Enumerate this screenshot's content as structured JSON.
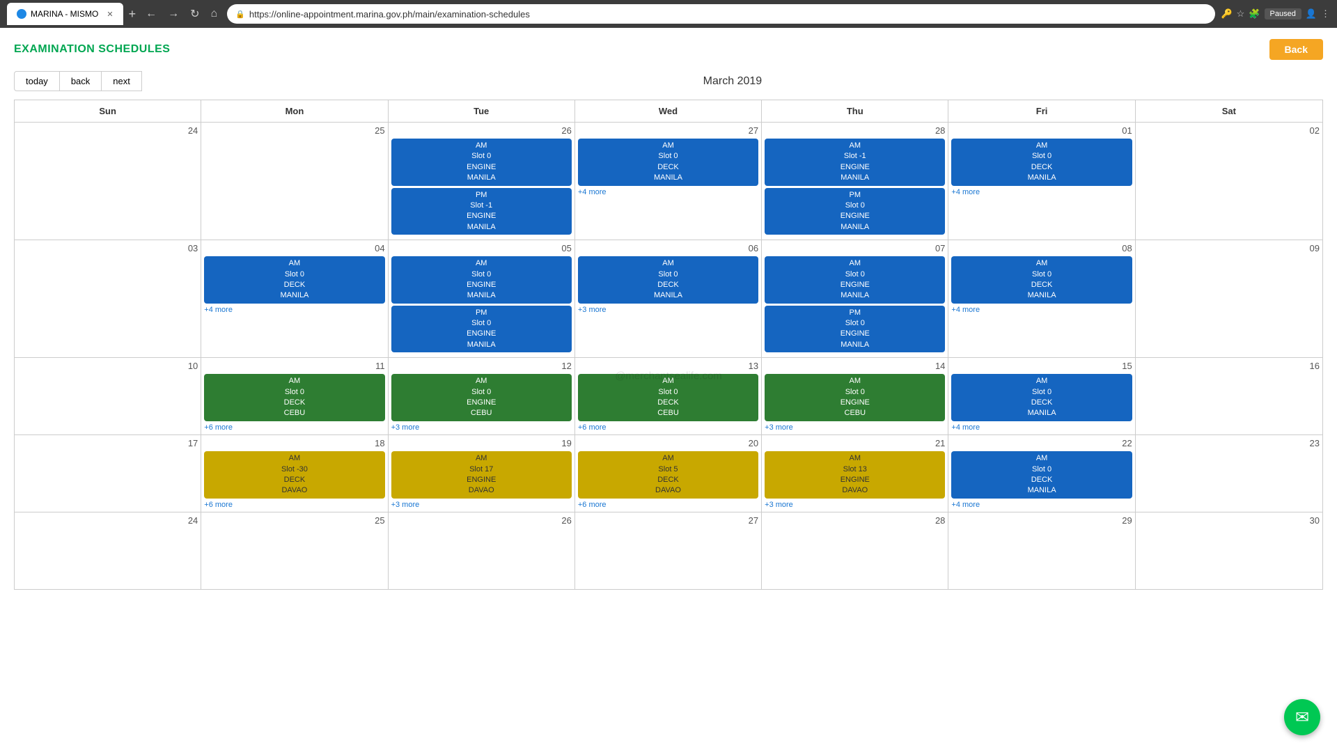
{
  "browser": {
    "tab_title": "MARINA - MISMO",
    "url": "https://online-appointment.marina.gov.ph/main/examination-schedules",
    "paused_label": "Paused"
  },
  "page": {
    "title": "EXAMINATION SCHEDULES",
    "back_button": "Back"
  },
  "calendar": {
    "nav": {
      "today": "today",
      "back": "back",
      "next": "next"
    },
    "month_label": "March 2019",
    "headers": [
      "Sun",
      "Mon",
      "Tue",
      "Wed",
      "Thu",
      "Fri",
      "Sat"
    ],
    "watermark": "@merchantsealife.com"
  },
  "rows": [
    {
      "cells": [
        {
          "day": "24",
          "events": [],
          "more": ""
        },
        {
          "day": "25",
          "events": [],
          "more": ""
        },
        {
          "day": "26",
          "events": [
            {
              "color": "blue",
              "lines": [
                "AM",
                "Slot 0",
                "ENGINE",
                "MANILA"
              ]
            },
            {
              "color": "blue",
              "lines": [
                "PM",
                "Slot -1",
                "ENGINE",
                "MANILA"
              ]
            }
          ],
          "more": ""
        },
        {
          "day": "27",
          "events": [
            {
              "color": "blue",
              "lines": [
                "AM",
                "Slot 0",
                "DECK",
                "MANILA"
              ]
            }
          ],
          "more": "+4 more"
        },
        {
          "day": "28",
          "events": [
            {
              "color": "blue",
              "lines": [
                "AM",
                "Slot -1",
                "ENGINE",
                "MANILA"
              ]
            },
            {
              "color": "blue",
              "lines": [
                "PM",
                "Slot 0",
                "ENGINE",
                "MANILA"
              ]
            }
          ],
          "more": ""
        },
        {
          "day": "01",
          "events": [
            {
              "color": "blue",
              "lines": [
                "AM",
                "Slot 0",
                "DECK",
                "MANILA"
              ]
            }
          ],
          "more": "+4 more"
        },
        {
          "day": "02",
          "events": [],
          "more": ""
        }
      ]
    },
    {
      "cells": [
        {
          "day": "03",
          "events": [],
          "more": ""
        },
        {
          "day": "04",
          "events": [
            {
              "color": "blue",
              "lines": [
                "AM",
                "Slot 0",
                "DECK",
                "MANILA"
              ]
            }
          ],
          "more": "+4 more"
        },
        {
          "day": "05",
          "events": [
            {
              "color": "blue",
              "lines": [
                "AM",
                "Slot 0",
                "ENGINE",
                "MANILA"
              ]
            },
            {
              "color": "blue",
              "lines": [
                "PM",
                "Slot 0",
                "ENGINE",
                "MANILA"
              ]
            }
          ],
          "more": ""
        },
        {
          "day": "06",
          "events": [
            {
              "color": "blue",
              "lines": [
                "AM",
                "Slot 0",
                "DECK",
                "MANILA"
              ]
            }
          ],
          "more": "+3 more"
        },
        {
          "day": "07",
          "events": [
            {
              "color": "blue",
              "lines": [
                "AM",
                "Slot 0",
                "ENGINE",
                "MANILA"
              ]
            },
            {
              "color": "blue",
              "lines": [
                "PM",
                "Slot 0",
                "ENGINE",
                "MANILA"
              ]
            }
          ],
          "more": ""
        },
        {
          "day": "08",
          "events": [
            {
              "color": "blue",
              "lines": [
                "AM",
                "Slot 0",
                "DECK",
                "MANILA"
              ]
            }
          ],
          "more": "+4 more"
        },
        {
          "day": "09",
          "events": [],
          "more": ""
        }
      ]
    },
    {
      "cells": [
        {
          "day": "10",
          "events": [],
          "more": ""
        },
        {
          "day": "11",
          "events": [
            {
              "color": "green",
              "lines": [
                "AM",
                "Slot 0",
                "DECK",
                "CEBU"
              ]
            }
          ],
          "more": "+6 more"
        },
        {
          "day": "12",
          "events": [
            {
              "color": "green",
              "lines": [
                "AM",
                "Slot 0",
                "ENGINE",
                "CEBU"
              ]
            }
          ],
          "more": "+3 more"
        },
        {
          "day": "13",
          "events": [
            {
              "color": "green",
              "lines": [
                "AM",
                "Slot 0",
                "DECK",
                "CEBU"
              ]
            }
          ],
          "more": "+6 more"
        },
        {
          "day": "14",
          "events": [
            {
              "color": "green",
              "lines": [
                "AM",
                "Slot 0",
                "ENGINE",
                "CEBU"
              ]
            }
          ],
          "more": "+3 more"
        },
        {
          "day": "15",
          "events": [
            {
              "color": "blue",
              "lines": [
                "AM",
                "Slot 0",
                "DECK",
                "MANILA"
              ]
            }
          ],
          "more": "+4 more"
        },
        {
          "day": "16",
          "events": [],
          "more": ""
        }
      ]
    },
    {
      "cells": [
        {
          "day": "17",
          "events": [],
          "more": ""
        },
        {
          "day": "18",
          "events": [
            {
              "color": "yellow",
              "lines": [
                "AM",
                "Slot -30",
                "DECK",
                "DAVAO"
              ]
            }
          ],
          "more": "+6 more"
        },
        {
          "day": "19",
          "events": [
            {
              "color": "yellow",
              "lines": [
                "AM",
                "Slot 17",
                "ENGINE",
                "DAVAO"
              ]
            }
          ],
          "more": "+3 more"
        },
        {
          "day": "20",
          "events": [
            {
              "color": "yellow",
              "lines": [
                "AM",
                "Slot 5",
                "DECK",
                "DAVAO"
              ]
            }
          ],
          "more": "+6 more"
        },
        {
          "day": "21",
          "events": [
            {
              "color": "yellow",
              "lines": [
                "AM",
                "Slot 13",
                "ENGINE",
                "DAVAO"
              ]
            }
          ],
          "more": "+3 more"
        },
        {
          "day": "22",
          "events": [
            {
              "color": "blue",
              "lines": [
                "AM",
                "Slot 0",
                "DECK",
                "MANILA"
              ]
            }
          ],
          "more": "+4 more"
        },
        {
          "day": "23",
          "events": [],
          "more": ""
        }
      ]
    },
    {
      "cells": [
        {
          "day": "24",
          "events": [],
          "more": ""
        },
        {
          "day": "25",
          "events": [],
          "more": ""
        },
        {
          "day": "26",
          "events": [],
          "more": ""
        },
        {
          "day": "27",
          "events": [],
          "more": ""
        },
        {
          "day": "28",
          "events": [],
          "more": ""
        },
        {
          "day": "29",
          "events": [],
          "more": ""
        },
        {
          "day": "30",
          "events": [],
          "more": ""
        }
      ]
    }
  ]
}
